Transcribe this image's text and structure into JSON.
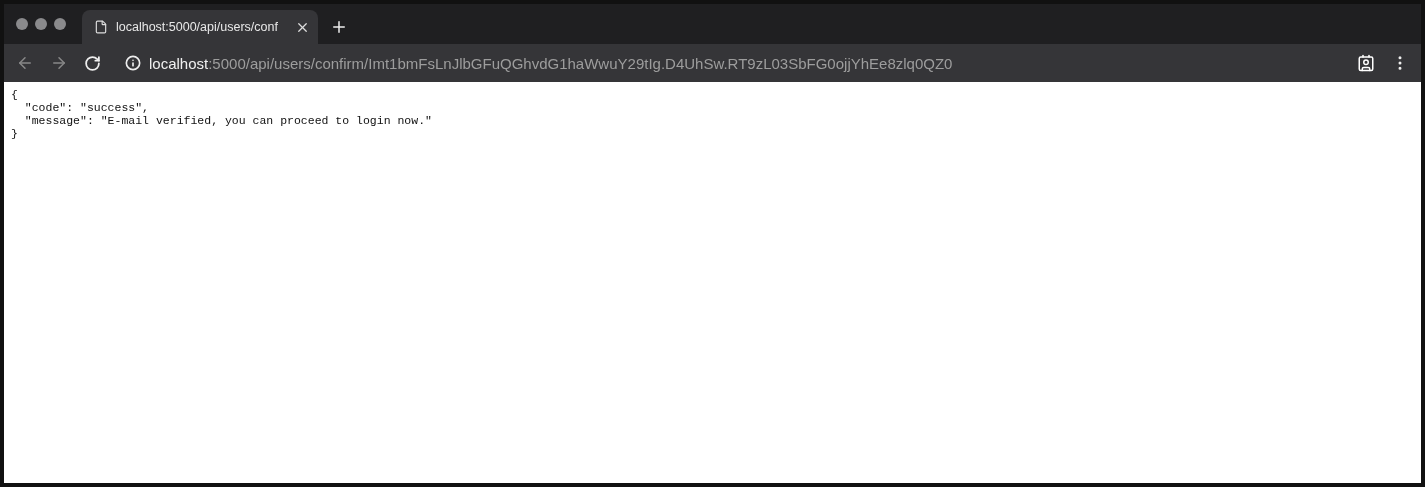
{
  "tabs": [
    {
      "title": "localhost:5000/api/users/conf",
      "selected": true
    }
  ],
  "address_bar": {
    "host": "localhost",
    "path": ":5000/api/users/confirm/Imt1bmFsLnJlbGFuQGhvdG1haWwuY29tIg.D4UhSw.RT9zL03SbFG0ojjYhEe8zlq0QZ0"
  },
  "page": {
    "lines": [
      "{",
      "  \"code\": \"success\",",
      "  \"message\": \"E-mail verified, you can proceed to login now.\"",
      "}"
    ]
  }
}
